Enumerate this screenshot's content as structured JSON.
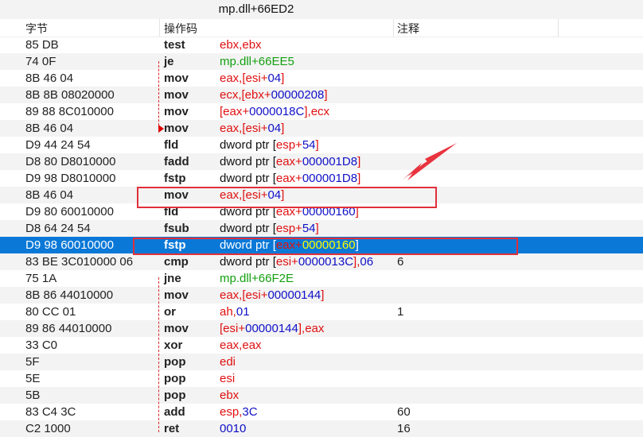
{
  "window": {
    "title": "mp.dll+66ED2"
  },
  "columns": {
    "bytes": "字节",
    "opcode": "操作码",
    "comment": "注释"
  },
  "colors": {
    "selection": "#0a78d7",
    "register": "#e01010",
    "immediate": "#1010c8",
    "address": "#13a010",
    "highlight_box": "#e0303a"
  },
  "rows": [
    {
      "bytes": "85 DB",
      "op": "test",
      "args": [
        {
          "t": "ebx,ebx",
          "c": "r"
        }
      ],
      "comment": ""
    },
    {
      "bytes": "74 0F",
      "op": "je",
      "args": [
        {
          "t": "mp.dll+66EE5",
          "c": "g"
        }
      ],
      "comment": ""
    },
    {
      "bytes": "8B 46 04",
      "op": "mov",
      "args": [
        {
          "t": "eax,[esi+",
          "c": "r"
        },
        {
          "t": "04",
          "c": "b"
        },
        {
          "t": "]",
          "c": "r"
        }
      ],
      "comment": ""
    },
    {
      "bytes": "8B 8B 08020000",
      "op": "mov",
      "args": [
        {
          "t": "ecx,[ebx+",
          "c": "r"
        },
        {
          "t": "00000208",
          "c": "b"
        },
        {
          "t": "]",
          "c": "r"
        }
      ],
      "comment": ""
    },
    {
      "bytes": "89 88 8C010000",
      "op": "mov",
      "args": [
        {
          "t": "[eax+",
          "c": "r"
        },
        {
          "t": "0000018C",
          "c": "b"
        },
        {
          "t": "],ecx",
          "c": "r"
        }
      ],
      "comment": ""
    },
    {
      "bytes": "8B 46 04",
      "op": "mov",
      "args": [
        {
          "t": "eax,[esi+",
          "c": "r"
        },
        {
          "t": "04",
          "c": "b"
        },
        {
          "t": "]",
          "c": "r"
        }
      ],
      "comment": ""
    },
    {
      "bytes": "D9 44 24 54",
      "op": "fld",
      "args": [
        {
          "t": "dword ptr [",
          "c": "t"
        },
        {
          "t": "esp+",
          "c": "r"
        },
        {
          "t": "54",
          "c": "b"
        },
        {
          "t": "]",
          "c": "r"
        }
      ],
      "comment": ""
    },
    {
      "bytes": "D8 80 D8010000",
      "op": "fadd",
      "args": [
        {
          "t": "dword ptr [",
          "c": "t"
        },
        {
          "t": "eax+",
          "c": "r"
        },
        {
          "t": "000001D8",
          "c": "b"
        },
        {
          "t": "]",
          "c": "r"
        }
      ],
      "comment": ""
    },
    {
      "bytes": "D9 98 D8010000",
      "op": "fstp",
      "args": [
        {
          "t": "dword ptr [",
          "c": "t"
        },
        {
          "t": "eax+",
          "c": "r"
        },
        {
          "t": "000001D8",
          "c": "b"
        },
        {
          "t": "]",
          "c": "r"
        }
      ],
      "comment": ""
    },
    {
      "bytes": "8B 46 04",
      "op": "mov",
      "args": [
        {
          "t": "eax,[esi+",
          "c": "r"
        },
        {
          "t": "04",
          "c": "b"
        },
        {
          "t": "]",
          "c": "r"
        }
      ],
      "comment": ""
    },
    {
      "bytes": "D9 80 60010000",
      "op": "fld",
      "args": [
        {
          "t": "dword ptr [",
          "c": "t"
        },
        {
          "t": "eax+",
          "c": "r"
        },
        {
          "t": "00000160",
          "c": "b"
        },
        {
          "t": "]",
          "c": "r"
        }
      ],
      "comment": ""
    },
    {
      "bytes": "D8 64 24 54",
      "op": "fsub",
      "args": [
        {
          "t": "dword ptr [",
          "c": "t"
        },
        {
          "t": "esp+",
          "c": "r"
        },
        {
          "t": "54",
          "c": "b"
        },
        {
          "t": "]",
          "c": "r"
        }
      ],
      "comment": ""
    },
    {
      "bytes": "D9 98 60010000",
      "op": "fstp",
      "args": [
        {
          "t": "dword ptr [",
          "c": "t"
        },
        {
          "t": "eax+",
          "c": "r"
        },
        {
          "t": "00000160",
          "c": "b"
        },
        {
          "t": "]",
          "c": "t"
        }
      ],
      "comment": "",
      "selected": true
    },
    {
      "bytes": "83 BE 3C010000 06",
      "op": "cmp",
      "args": [
        {
          "t": "dword ptr [",
          "c": "t"
        },
        {
          "t": "esi+",
          "c": "r"
        },
        {
          "t": "0000013C",
          "c": "b"
        },
        {
          "t": "],",
          "c": "r"
        },
        {
          "t": "06",
          "c": "b"
        }
      ],
      "comment": "6"
    },
    {
      "bytes": "75 1A",
      "op": "jne",
      "args": [
        {
          "t": "mp.dll+66F2E",
          "c": "g"
        }
      ],
      "comment": ""
    },
    {
      "bytes": "8B 86 44010000",
      "op": "mov",
      "args": [
        {
          "t": "eax,[esi+",
          "c": "r"
        },
        {
          "t": "00000144",
          "c": "b"
        },
        {
          "t": "]",
          "c": "r"
        }
      ],
      "comment": ""
    },
    {
      "bytes": "80 CC 01",
      "op": "or",
      "args": [
        {
          "t": "ah,",
          "c": "r"
        },
        {
          "t": "01",
          "c": "b"
        }
      ],
      "comment": "1"
    },
    {
      "bytes": "89 86 44010000",
      "op": "mov",
      "args": [
        {
          "t": "[esi+",
          "c": "r"
        },
        {
          "t": "00000144",
          "c": "b"
        },
        {
          "t": "],eax",
          "c": "r"
        }
      ],
      "comment": ""
    },
    {
      "bytes": "33 C0",
      "op": "xor",
      "args": [
        {
          "t": "eax,eax",
          "c": "r"
        }
      ],
      "comment": ""
    },
    {
      "bytes": "5F",
      "op": "pop",
      "args": [
        {
          "t": "edi",
          "c": "r"
        }
      ],
      "comment": ""
    },
    {
      "bytes": "5E",
      "op": "pop",
      "args": [
        {
          "t": "esi",
          "c": "r"
        }
      ],
      "comment": ""
    },
    {
      "bytes": "5B",
      "op": "pop",
      "args": [
        {
          "t": "ebx",
          "c": "r"
        }
      ],
      "comment": ""
    },
    {
      "bytes": "83 C4 3C",
      "op": "add",
      "args": [
        {
          "t": "esp,",
          "c": "r"
        },
        {
          "t": "3C",
          "c": "b"
        }
      ],
      "comment": "60"
    },
    {
      "bytes": "C2 1000",
      "op": "ret",
      "args": [
        {
          "t": "0010",
          "c": "b"
        }
      ],
      "comment": "16"
    }
  ]
}
